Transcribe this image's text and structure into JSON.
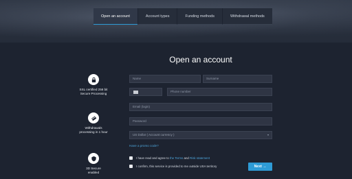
{
  "tabs": [
    {
      "label": "Open an account",
      "active": true
    },
    {
      "label": "Account types",
      "active": false
    },
    {
      "label": "Funding methods",
      "active": false
    },
    {
      "label": "Withdrawal methods",
      "active": false
    }
  ],
  "title": "Open an account",
  "features": [
    {
      "icon": "lock-icon",
      "text_line1": "SSL certified 256 bit",
      "text_line2": "Secure Processing"
    },
    {
      "icon": "card-icon",
      "text_line1": "Withdrawals",
      "text_line2": "processing in 1 hour"
    },
    {
      "icon": "shield-icon",
      "text_line1": "3D Secure",
      "text_line2": "enabled"
    }
  ],
  "form": {
    "name_placeholder": "Name",
    "surname_placeholder": "Surname",
    "phone_placeholder": "Phone number",
    "email_placeholder": "Email (login)",
    "password_placeholder": "Password",
    "currency_value": "US Dollar ( Account currency )",
    "promo_link": "Have a promo code?",
    "terms_prefix": "I have read and agree to ",
    "terms_link": "the Terms",
    "terms_and": " and ",
    "risk_link": "Risk statement",
    "usa_text": "I confirm, this service is provided to me outside USA territory",
    "next_label": "Next →"
  },
  "colors": {
    "accent": "#2e9bd6",
    "background": "#1d2330",
    "field": "#2f3544"
  }
}
